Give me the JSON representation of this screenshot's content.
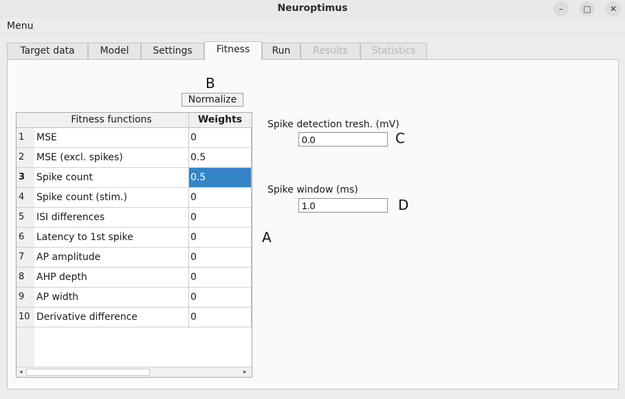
{
  "window": {
    "title": "Neuroptimus",
    "minimize": "–",
    "maximize": "□",
    "close": "✕"
  },
  "menu": {
    "label": "Menu"
  },
  "tabs": [
    {
      "label": "Target data",
      "state": "normal"
    },
    {
      "label": "Model",
      "state": "normal"
    },
    {
      "label": "Settings",
      "state": "normal"
    },
    {
      "label": "Fitness",
      "state": "active"
    },
    {
      "label": "Run",
      "state": "normal"
    },
    {
      "label": "Results",
      "state": "disabled"
    },
    {
      "label": "Statistics",
      "state": "disabled"
    }
  ],
  "annotations": {
    "a": "A",
    "b": "B",
    "c": "C",
    "d": "D"
  },
  "normalize_button": "Normalize",
  "table": {
    "columns": [
      "Fitness functions",
      "Weights"
    ],
    "rows": [
      {
        "num": "1",
        "name": "MSE",
        "weight": "0"
      },
      {
        "num": "2",
        "name": "MSE (excl. spikes)",
        "weight": "0.5"
      },
      {
        "num": "3",
        "name": "Spike count",
        "weight": "0.5"
      },
      {
        "num": "4",
        "name": "Spike count (stim.)",
        "weight": "0"
      },
      {
        "num": "5",
        "name": "ISI differences",
        "weight": "0"
      },
      {
        "num": "6",
        "name": "Latency to 1st spike",
        "weight": "0"
      },
      {
        "num": "7",
        "name": "AP amplitude",
        "weight": "0"
      },
      {
        "num": "8",
        "name": "AHP depth",
        "weight": "0"
      },
      {
        "num": "9",
        "name": "AP width",
        "weight": "0"
      },
      {
        "num": "10",
        "name": "Derivative difference",
        "weight": "0"
      }
    ],
    "selected_row": 3
  },
  "spike_detection": {
    "label": "Spike detection tresh. (mV)",
    "value": "0.0"
  },
  "spike_window": {
    "label": "Spike window (ms)",
    "value": "1.0"
  },
  "colors": {
    "selection": "#3584c6"
  }
}
